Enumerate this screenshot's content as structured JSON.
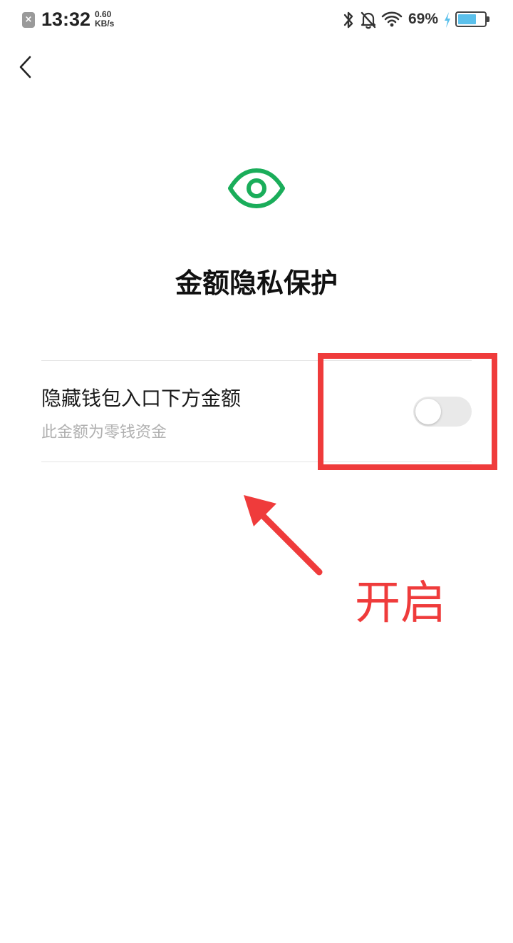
{
  "status_bar": {
    "time": "13:32",
    "net_speed_value": "0.60",
    "net_speed_unit": "KB/s",
    "battery_percent": "69%",
    "battery_level": 0.69,
    "icons": [
      "notification-x-icon",
      "bluetooth-icon",
      "bell-off-icon",
      "wifi-icon",
      "charging-icon",
      "battery-icon"
    ]
  },
  "header": {
    "back_icon": "chevron-left-icon"
  },
  "page": {
    "icon": "eye-icon",
    "icon_color": "#1aad5a",
    "title": "金额隐私保护"
  },
  "setting": {
    "title": "隐藏钱包入口下方金额",
    "subtitle": "此金额为零钱资金",
    "toggle_on": false
  },
  "annotation": {
    "label": "开启",
    "color": "#ef3b3b"
  }
}
